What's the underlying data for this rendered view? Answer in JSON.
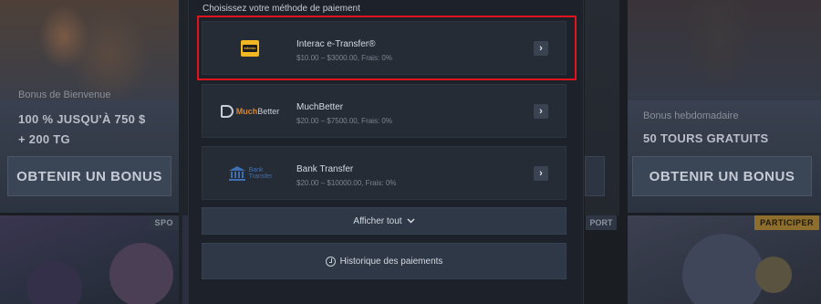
{
  "modal": {
    "title": "Choisissez votre méthode de paiement",
    "methods": [
      {
        "name": "Interac e-Transfer®",
        "details": "$10.00 – $3000.00, Frais: 0%",
        "logo": "interac-logo",
        "logo_text": "interac",
        "selected": true
      },
      {
        "name": "MuchBetter",
        "details": "$20.00 – $7500.00, Frais: 0%",
        "logo": "muchbetter-logo",
        "logo_text_brand": "Much",
        "logo_text_rest": "Better"
      },
      {
        "name": "Bank Transfer",
        "details": "$20.00 – $10000.00, Frais: 0%",
        "logo": "bank-transfer-logo",
        "logo_text_line1": "Bank",
        "logo_text_line2": "Transfer"
      }
    ],
    "show_all_label": "Afficher tout",
    "history_label": "Historique des paiements",
    "highlight_color": "#e0141c"
  },
  "background": {
    "left_promo": {
      "title": "Bonus de Bienvenue",
      "headline_line1": "100 % JUSQU'À 750 $",
      "headline_line2": "+ 200 TG",
      "button": "OBTENIR UN BONUS"
    },
    "right_promo": {
      "title": "Bonus hebdomadaire",
      "headline": "50 TOURS GRATUITS",
      "button": "OBTENIR UN BONUS"
    },
    "left_game_tag": "SPO",
    "right_game_tag": "PARTICIPER",
    "middle_tag": "PORT"
  }
}
